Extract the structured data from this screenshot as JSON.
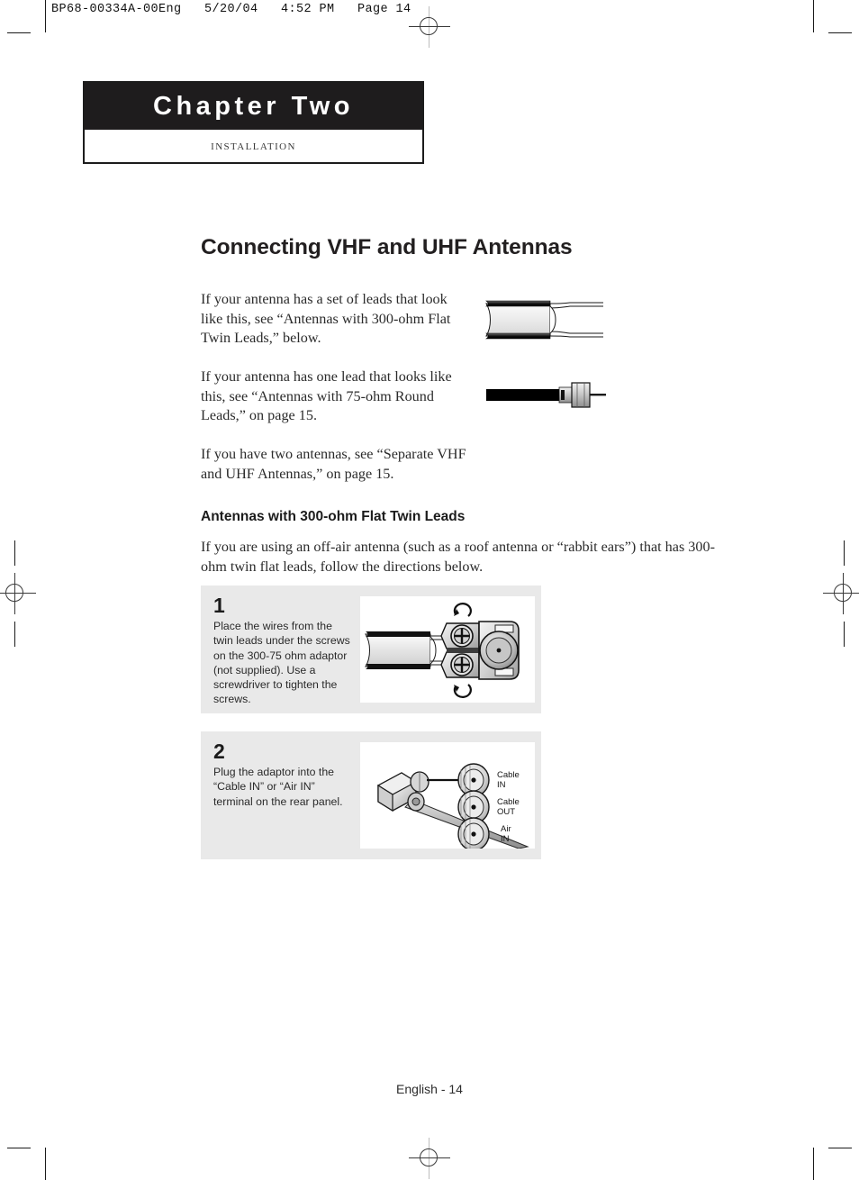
{
  "print_slug": "BP68-00334A-00Eng   5/20/04   4:52 PM   Page 14",
  "chapter": {
    "title": "Chapter Two",
    "subtitle": "Installation"
  },
  "main_heading": "Connecting VHF and UHF Antennas",
  "paragraphs": {
    "p1": "If your antenna has a set of leads that look like this, see “Antennas with 300-ohm Flat Twin Leads,” below.",
    "p2": "If your antenna has one lead that looks like this, see “Antennas with 75-ohm Round Leads,” on page 15.",
    "p3": "If you have two antennas, see “Separate VHF and UHF Antennas,” on page 15.",
    "p4": "If you are using an off-air antenna (such as a roof antenna or “rabbit ears”) that has 300-ohm twin flat leads, follow the directions below."
  },
  "sub_heading": "Antennas with 300-ohm Flat Twin Leads",
  "steps": [
    {
      "number": "1",
      "text": "Place the wires from the twin leads under the screws on the 300-75 ohm adaptor (not supplied). Use a screwdriver to tighten the screws.",
      "figure_name": "adaptor-screws-illustration"
    },
    {
      "number": "2",
      "text": "Plug the adaptor into the “Cable IN” or “Air IN” terminal on the rear panel.",
      "figure_name": "rear-panel-terminals-illustration"
    }
  ],
  "terminal_labels": [
    {
      "line1": "Cable",
      "line2": "IN"
    },
    {
      "line1": "Cable",
      "line2": "OUT"
    },
    {
      "line1": "Air",
      "line2": "IN"
    }
  ],
  "footer": "English - 14",
  "colors": {
    "banner_background": "#1e1c1d",
    "banner_text": "#ffffff",
    "panel_background": "#e9e9e9",
    "figure_background": "#ffffff",
    "body_text": "#2b2b2b"
  }
}
